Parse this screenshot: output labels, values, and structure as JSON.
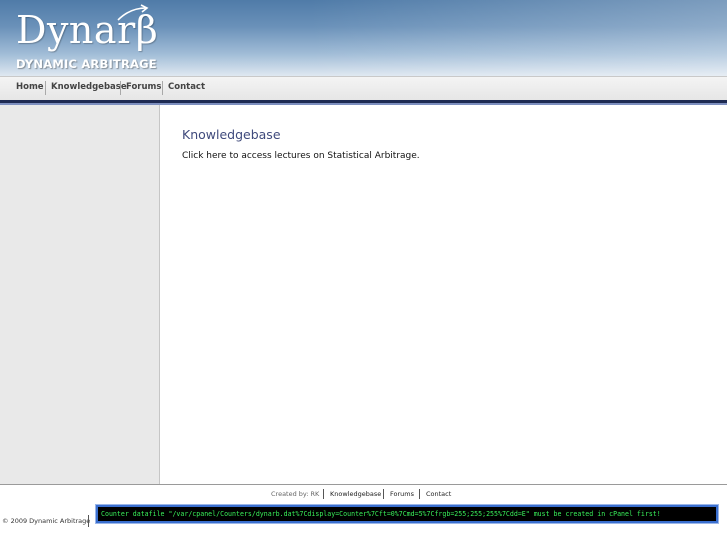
{
  "header": {
    "logo_text": "Dynarβ",
    "logo_subtitle": "DYNAMIC ARBITRAGE"
  },
  "nav": {
    "items": [
      {
        "label": "Home"
      },
      {
        "label": "Knowledgebase"
      },
      {
        "label": "Forums"
      },
      {
        "label": "Contact"
      }
    ]
  },
  "main": {
    "title": "Knowledgebase",
    "body": "Click here to access lectures on Statistical Arbitrage."
  },
  "footer": {
    "credit": "Created by: RK",
    "links": [
      {
        "label": "Knowledgebase"
      },
      {
        "label": "Forums"
      },
      {
        "label": "Contact"
      }
    ],
    "copyright": "© 2009 Dynamic Arbitrage",
    "counter_message": "Counter datafile \"/var/cpanel/Counters/dynarb.dat%7Cdisplay=Counter%7Cft=0%7Cmd=5%7Cfrgb=255;255;255%7Cdd=E\" must be created in cPanel first!"
  },
  "colors": {
    "header_top": "#4f7ba8",
    "nav_rule": "#1e2a52",
    "title_color": "#3f4a7c",
    "sidebar_bg": "#e9e9e9",
    "counter_text": "#39f05a"
  }
}
